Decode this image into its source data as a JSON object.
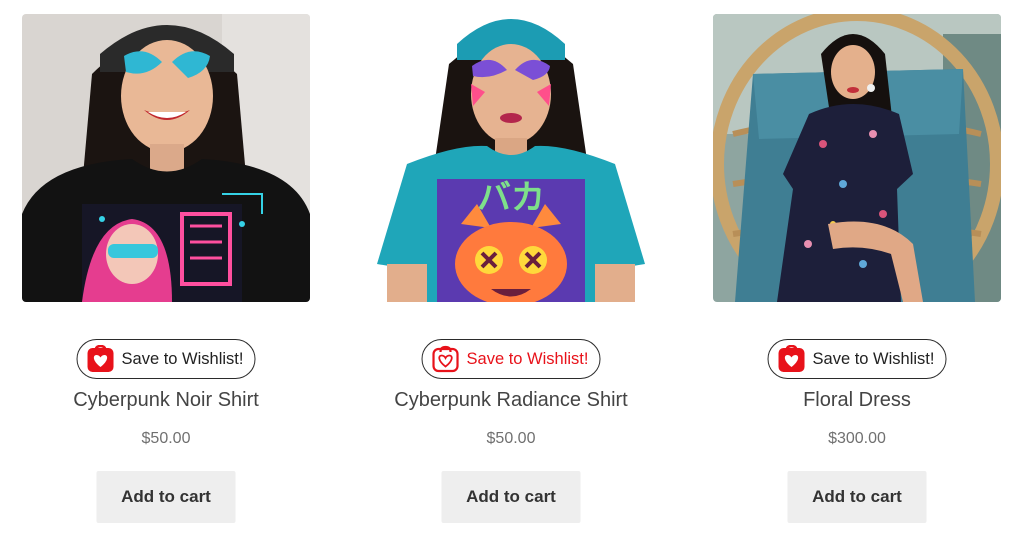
{
  "colors": {
    "wishlist_icon_fill": "#e8121a",
    "wishlist_saved_text": "#e8121a",
    "cart_button_bg": "#eeeeee",
    "price_text": "#707070"
  },
  "products": [
    {
      "image_alt": "Cyberpunk Noir Shirt",
      "wishlist_label": "Save to Wishlist!",
      "wishlist_icon": "heart-bag-icon",
      "wishlist_state": "default",
      "title": "Cyberpunk Noir Shirt",
      "price": "$50.00",
      "cart_label": "Add to cart"
    },
    {
      "image_alt": "Cyberpunk Radiance Shirt",
      "wishlist_label": "Save to Wishlist!",
      "wishlist_icon": "heart-bag-outline-icon",
      "wishlist_state": "highlighted",
      "title": "Cyberpunk Radiance Shirt",
      "price": "$50.00",
      "cart_label": "Add to cart"
    },
    {
      "image_alt": "Floral Dress",
      "wishlist_label": "Save to Wishlist!",
      "wishlist_icon": "heart-bag-icon",
      "wishlist_state": "default",
      "title": "Floral Dress",
      "price": "$300.00",
      "cart_label": "Add to cart"
    }
  ]
}
